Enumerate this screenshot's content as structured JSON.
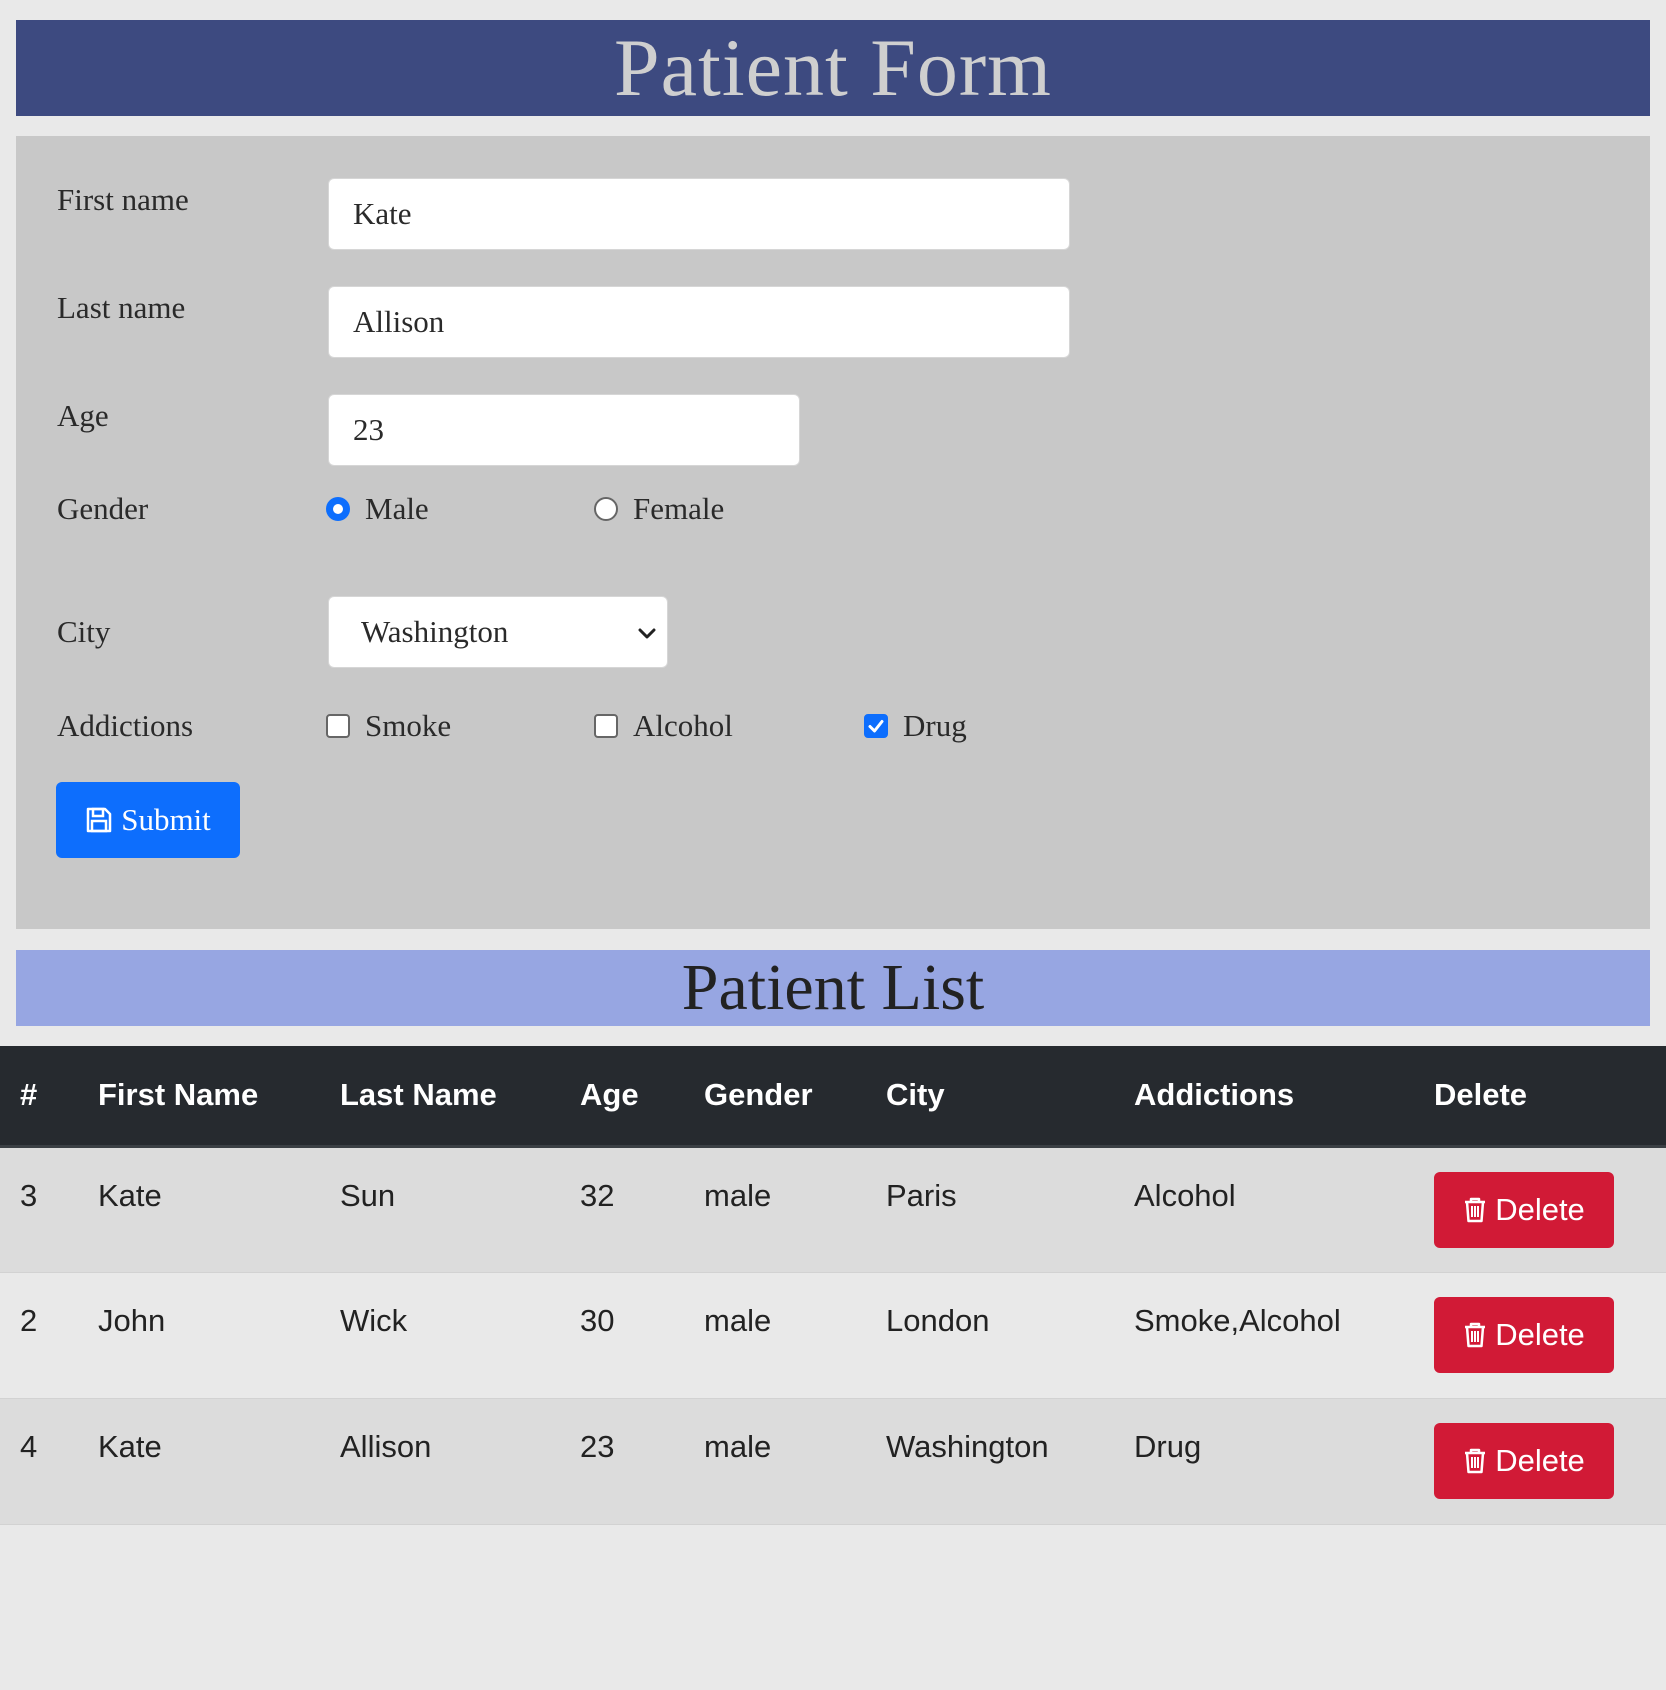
{
  "form": {
    "title": "Patient Form",
    "first_name": {
      "label": "First name",
      "value": "Kate"
    },
    "last_name": {
      "label": "Last name",
      "value": "Allison"
    },
    "age": {
      "label": "Age",
      "value": "23"
    },
    "gender": {
      "label": "Gender",
      "options": [
        "Male",
        "Female"
      ],
      "selected": "Male"
    },
    "city": {
      "label": "City",
      "selected": "Washington"
    },
    "addictions": {
      "label": "Addictions",
      "options": [
        "Smoke",
        "Alcohol",
        "Drug"
      ],
      "checked": [
        "Drug"
      ]
    },
    "submit_label": "Submit",
    "submit_icon": "floppy-disk-icon"
  },
  "list": {
    "title": "Patient List",
    "columns": [
      "#",
      "First Name",
      "Last Name",
      "Age",
      "Gender",
      "City",
      "Addictions",
      "Delete"
    ],
    "rows": [
      {
        "id": "3",
        "first": "Kate",
        "last": "Sun",
        "age": "32",
        "gender": "male",
        "city": "Paris",
        "addictions": "Alcohol",
        "delete": "Delete"
      },
      {
        "id": "2",
        "first": "John",
        "last": "Wick",
        "age": "30",
        "gender": "male",
        "city": "London",
        "addictions": "Smoke,Alcohol",
        "delete": "Delete"
      },
      {
        "id": "4",
        "first": "Kate",
        "last": "Allison",
        "age": "23",
        "gender": "male",
        "city": "Washington",
        "addictions": "Drug",
        "delete": "Delete"
      }
    ],
    "delete_icon": "trash-icon"
  },
  "colors": {
    "form_header": "#3d4a80",
    "list_header": "#97a6e2",
    "primary": "#0d6efd",
    "danger": "#d11a36",
    "table_head": "#262a2f"
  }
}
